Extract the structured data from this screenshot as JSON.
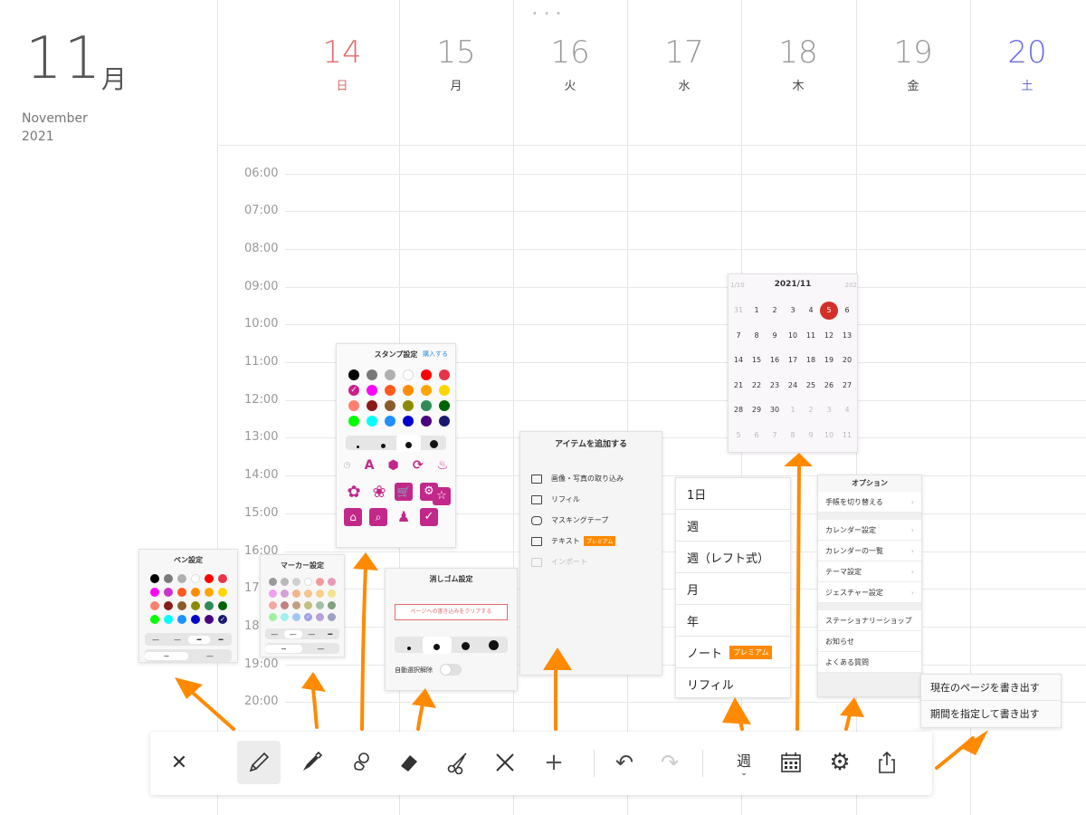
{
  "header": {
    "month_number": "11",
    "month_kanji": "月",
    "month_english": "November",
    "year": "2021"
  },
  "week_days": [
    {
      "num": "14",
      "wd": "日",
      "color": "#e06a6a"
    },
    {
      "num": "15",
      "wd": "月",
      "color": "#999999"
    },
    {
      "num": "16",
      "wd": "火",
      "color": "#999999"
    },
    {
      "num": "17",
      "wd": "水",
      "color": "#999999"
    },
    {
      "num": "18",
      "wd": "木",
      "color": "#999999"
    },
    {
      "num": "19",
      "wd": "金",
      "color": "#999999"
    },
    {
      "num": "20",
      "wd": "土",
      "color": "#6b6be0"
    }
  ],
  "times": [
    "06:00",
    "07:00",
    "08:00",
    "09:00",
    "10:00",
    "11:00",
    "12:00",
    "13:00",
    "14:00",
    "15:00",
    "16:00",
    "17:00",
    "18:00",
    "19:00",
    "20:00"
  ],
  "pen_settings": {
    "title": "ペン設定",
    "colors": [
      "#000000",
      "#7a7a7a",
      "#b0b0b0",
      "#ffffff",
      "#ff0000",
      "#e8344a",
      "#ff00ff",
      "#cc33cc",
      "#ff5a1e",
      "#ff8c00",
      "#ffa500",
      "#ffd700",
      "#ff7f6e",
      "#8b1a1a",
      "#8b5a2b",
      "#8b8b00",
      "#2e8b57",
      "#006400",
      "#00ff00",
      "#00ffff",
      "#1e90ff",
      "#0000cd",
      "#4b0082",
      "#1a1a6e"
    ]
  },
  "marker_settings": {
    "title": "マーカー設定",
    "colors": [
      "#9a9a9a",
      "#b8b8b8",
      "#d0d0d0",
      "#ffffff",
      "#f29a9a",
      "#e79bb6",
      "#f0a0f0",
      "#d4a0d4",
      "#f3b58c",
      "#f6c48e",
      "#f7d08c",
      "#f2e38c",
      "#f0a8a0",
      "#c08080",
      "#c0a080",
      "#c0c080",
      "#a0c0a8",
      "#80a080",
      "#a0f0a0",
      "#a0f0f0",
      "#a0c8f0",
      "#a0a0e8",
      "#b8a0d8",
      "#a0a0c0"
    ]
  },
  "stamp_settings": {
    "title": "スタンプ設定",
    "buy_label": "購入する",
    "colors": [
      "#000000",
      "#7a7a7a",
      "#b0b0b0",
      "#ffffff",
      "#ff0000",
      "#e8344a",
      "#cc1e8c",
      "#ff00ff",
      "#ff5a1e",
      "#ff8c00",
      "#ffa500",
      "#ffd700",
      "#ff7f6e",
      "#8b1a1a",
      "#8b5a2b",
      "#8b8b00",
      "#2e8b57",
      "#006400",
      "#00ff00",
      "#00ffff",
      "#1e90ff",
      "#0000cd",
      "#4b0082",
      "#1a1a6e"
    ],
    "accent": "#c2288a"
  },
  "eraser_settings": {
    "title": "消しゴム設定",
    "clear_label": "ページへの書き込みをクリアする",
    "auto_label": "自動選択解除"
  },
  "add_item": {
    "title": "アイテムを追加する",
    "items": [
      "画像・写真の取り込み",
      "リフィル",
      "マスキングテープ",
      "テキスト",
      "インポート"
    ],
    "premium_badge": "プレミアム"
  },
  "view_menu": {
    "items": [
      "1日",
      "週",
      "週（レフト式）",
      "月",
      "年",
      "ノート",
      "リフィル"
    ],
    "premium_badge": "プレミアム"
  },
  "mini_calendar": {
    "title": "2021/11",
    "prev": "1/10",
    "next": "202",
    "days": [
      "31",
      "1",
      "2",
      "3",
      "4",
      "5",
      "6",
      "7",
      "8",
      "9",
      "10",
      "11",
      "12",
      "13",
      "14",
      "15",
      "16",
      "17",
      "18",
      "19",
      "20",
      "21",
      "22",
      "23",
      "24",
      "25",
      "26",
      "27",
      "28",
      "29",
      "30",
      "1",
      "2",
      "3",
      "4",
      "5",
      "6",
      "7",
      "8",
      "9",
      "10",
      "11"
    ],
    "selected": "5"
  },
  "options": {
    "title": "オプション",
    "group1": [
      "手帳を切り替える"
    ],
    "group2": [
      "カレンダー設定",
      "カレンダーの一覧",
      "テーマ設定",
      "ジェスチャー設定"
    ],
    "group3": [
      "ステーショナリーショップ",
      "お知らせ",
      "よくある質問"
    ]
  },
  "export": {
    "items": [
      "現在のページを書き出す",
      "期間を指定して書き出す"
    ]
  },
  "toolbar": {
    "view_label": "週",
    "accent": "#ff8a00"
  }
}
